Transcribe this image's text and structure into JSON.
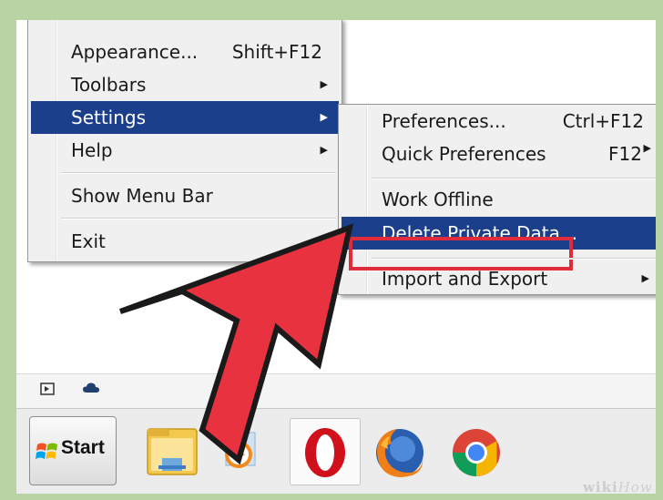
{
  "main_menu": {
    "items": [
      {
        "label": "Appearance...",
        "shortcut": "Shift+F12"
      },
      {
        "label": "Toolbars",
        "submenu": true
      },
      {
        "label": "Settings",
        "submenu": true,
        "active": true
      },
      {
        "label": "Help",
        "submenu": true
      },
      {
        "label": "Show Menu Bar"
      },
      {
        "label": "Exit"
      }
    ]
  },
  "settings_submenu": {
    "items": [
      {
        "label": "Preferences...",
        "shortcut": "Ctrl+F12"
      },
      {
        "label": "Quick Preferences",
        "shortcut": "F12",
        "submenu": true
      },
      {
        "label": "Work Offline"
      },
      {
        "label": "Delete Private Data...",
        "active": true,
        "highlighted": true
      },
      {
        "label": "Import and Export",
        "submenu": true
      }
    ]
  },
  "taskbar": {
    "start_label": "Start",
    "apps": [
      "file-explorer",
      "media-player",
      "opera",
      "firefox",
      "chrome"
    ]
  },
  "tray_icons": [
    "show-desktop-icon",
    "cloud-icon"
  ],
  "watermark": {
    "prefix": "wiki",
    "suffix": "How"
  },
  "colors": {
    "menu_highlight": "#1b3f8b",
    "callout_red": "#e02c3a",
    "arrow_red": "#e8323f"
  }
}
